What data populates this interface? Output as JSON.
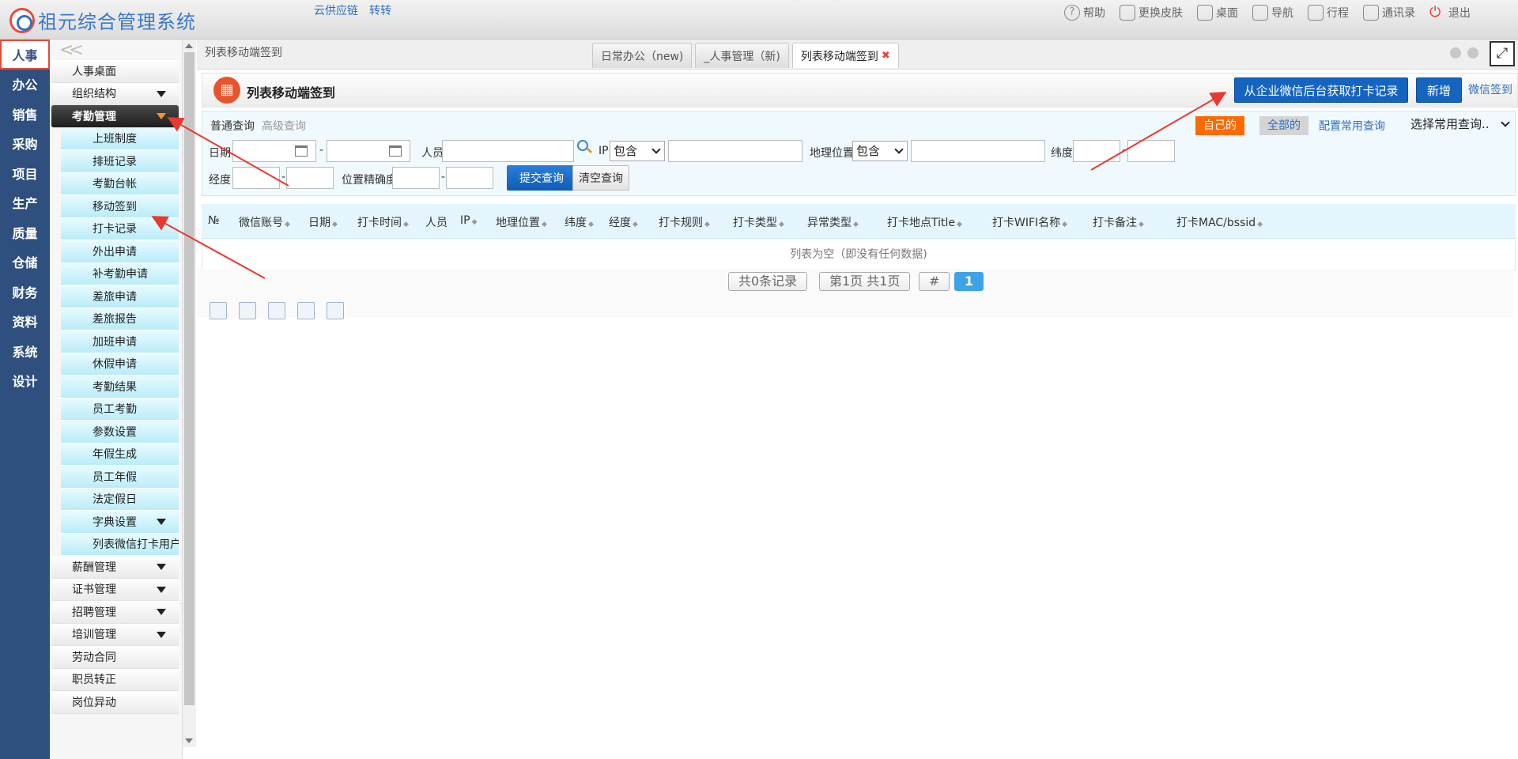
{
  "app": {
    "title": "祖元综合管理系统",
    "links": [
      "云供应链",
      "转转"
    ]
  },
  "toolbar": {
    "help": "帮助",
    "skin": "更换皮肤",
    "desktop": "桌面",
    "nav": "导航",
    "schedule": "行程",
    "contacts": "通讯录",
    "logout": "退出"
  },
  "modules": [
    "人事",
    "办公",
    "销售",
    "采购",
    "项目",
    "生产",
    "质量",
    "仓储",
    "财务",
    "资料",
    "系统",
    "设计"
  ],
  "submenu": {
    "collapse": "<<",
    "top_items": [
      "人事桌面",
      "组织结构"
    ],
    "group_open": "考勤管理",
    "children": [
      "上班制度",
      "排班记录",
      "考勤台帐",
      "移动签到",
      "打卡记录",
      "外出申请",
      "补考勤申请",
      "差旅申请",
      "差旅报告",
      "加班申请",
      "休假申请",
      "考勤结果",
      "员工考勤",
      "参数设置",
      "年假生成",
      "员工年假",
      "法定假日",
      "字典设置",
      "列表微信打卡用户"
    ],
    "bottom_items": [
      "薪酬管理",
      "证书管理",
      "招聘管理",
      "培训管理",
      "劳动合同",
      "职员转正",
      "岗位异动"
    ]
  },
  "breadcrumb": "列表移动端签到",
  "tabs": [
    "日常办公（new)",
    "_人事管理（新)",
    "列表移动端签到"
  ],
  "page": {
    "title": "列表移动端签到",
    "btn_fetch": "从企业微信后台获取打卡记录",
    "btn_add": "新增",
    "link_wx": "微信签到"
  },
  "search": {
    "tab_normal": "普通查询",
    "tab_advanced": "高级查询",
    "tag_mine": "自己的",
    "tag_all": "全部的",
    "config": "配置常用查询",
    "saved_query": "选择常用查询..",
    "date_label": "日期",
    "person_label": "人员",
    "ip_label": "IP",
    "ip_op": "包含",
    "geo_label": "地理位置",
    "geo_op": "包含",
    "lat_label": "纬度",
    "lng_label": "经度",
    "acc_label": "位置精确度",
    "dash": "-",
    "submit": "提交查询",
    "clear": "清空查询"
  },
  "grid": {
    "columns": [
      "№",
      "微信账号",
      "日期",
      "打卡时间",
      "人员",
      "IP",
      "地理位置",
      "纬度",
      "经度",
      "打卡规则",
      "打卡类型",
      "异常类型",
      "打卡地点Title",
      "打卡WIFI名称",
      "打卡备注",
      "打卡MAC/bssid"
    ],
    "sort_glyph": "◆",
    "empty": "列表为空（即没有任何数据)"
  },
  "pager": {
    "total": "共0条记录",
    "page": "第1页 共1页",
    "hash": "#",
    "current": "1"
  },
  "colors": {
    "module_bg": "#2f4f7f",
    "primary": "#1565c0",
    "tag_orange": "#ff6a00",
    "annotation": "#e8392f"
  }
}
